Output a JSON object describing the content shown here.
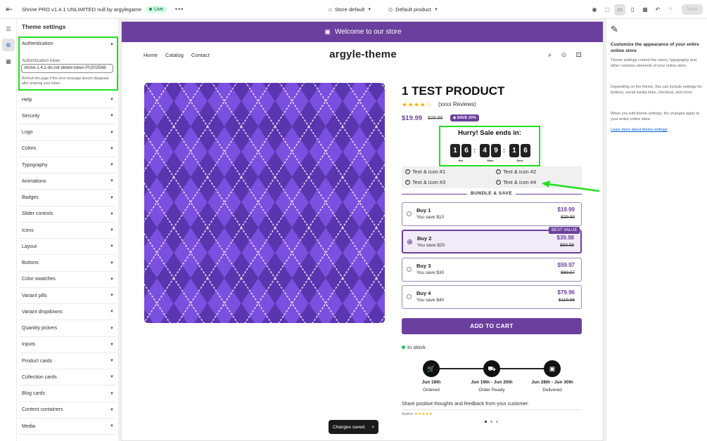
{
  "topbar": {
    "exit_icon": "exit-icon",
    "title": "Shrine PRO v1.4.1 UNLIMITED null by argylegame",
    "status": "Live",
    "more": "•••",
    "store_selector": "Store default",
    "template_selector": "Default product",
    "save": "Save"
  },
  "sidebar": {
    "title": "Theme settings",
    "auth": {
      "label": "Authentication",
      "field_label": "Authentication token",
      "field_value": "shrine-1.4.1-do-not-delete-token-PU202548-",
      "help": "Refresh the page if the error message doesnt disappear after entering your token."
    },
    "items": [
      "Help",
      "Security",
      "Logo",
      "Colors",
      "Typography",
      "Animations",
      "Badges",
      "Slider controls",
      "Icons",
      "Layout",
      "Buttons",
      "Color swatches",
      "Variant pills",
      "Variant dropdowns",
      "Quantity pickers",
      "Inputs",
      "Product cards",
      "Collection cards",
      "Blog cards",
      "Content containers",
      "Media"
    ]
  },
  "store": {
    "announcement": "Welcome to our store",
    "nav": [
      "Home",
      "Catalog",
      "Contact"
    ],
    "logo": "argyle-theme",
    "product": {
      "title": "1 TEST PRODUCT",
      "stars": "★★★★☆",
      "reviews": "(xxxx Reviews)",
      "rating": 4.5,
      "price": "$19.99",
      "compare_price": "$29.99",
      "save_badge": "SAVE 33%"
    },
    "timer": {
      "title": "Hurry! Sale ends in:",
      "hours": [
        "1",
        "6"
      ],
      "mins": [
        "4",
        "9"
      ],
      "secs": [
        "1",
        "6"
      ],
      "labels": [
        "Hrs",
        "Mins",
        "Secs"
      ]
    },
    "features": [
      "Text & icon #1",
      "Text & icon #2",
      "Text & icon #3",
      "Text & icon #4"
    ],
    "bundle": {
      "title": "BUNDLE & SAVE",
      "best_value": "BEST VALUE",
      "offers": [
        {
          "name": "Buy 1",
          "save": "You save $10",
          "price": "$19.99",
          "compare": "$29.99",
          "selected": false
        },
        {
          "name": "Buy 2",
          "save": "You save $20",
          "price": "$39.98",
          "compare": "$59.98",
          "selected": true
        },
        {
          "name": "Buy 3",
          "save": "You save $30",
          "price": "$59.97",
          "compare": "$89.97",
          "selected": false
        },
        {
          "name": "Buy 4",
          "save": "You save $40",
          "price": "$79.96",
          "compare": "$119.96",
          "selected": false
        }
      ]
    },
    "add_to_cart": "ADD TO CART",
    "stock": "In stock",
    "timeline": [
      {
        "date": "Jun 18th",
        "label": "Ordered",
        "icon": "cart-icon"
      },
      {
        "date": "Jun 19th - Jun 20th",
        "label": "Order Ready",
        "icon": "truck-icon"
      },
      {
        "date": "Jun 28th - Jun 30th",
        "label": "Delivered",
        "icon": "package-icon"
      }
    ],
    "testimonial": "Share positive thoughts and feedback from your customer.",
    "author": "Author",
    "author_stars": "★★★★★"
  },
  "toast": {
    "message": "Changes saved.",
    "close": "×"
  },
  "rpanel": {
    "title": "Customize the appearance of your entire online store",
    "p1": "Theme settings control the colors, typography and other common elements of your online store.",
    "p2": "Depending on the theme, this can include settings for buttons, social media links, checkout, and more.",
    "p3": "When you edit theme settings, the changes apply to your entire online store.",
    "link": "Learn more about theme settings"
  },
  "colors": {
    "accent": "#6b3f9d",
    "highlight": "#22e01e",
    "argyle_dark": "#1c1520",
    "argyle_light": "#7b4fe0"
  }
}
